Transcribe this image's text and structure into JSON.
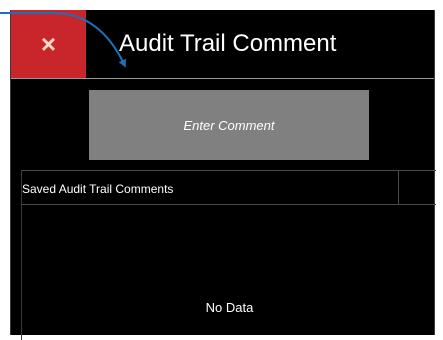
{
  "dialog": {
    "title": "Audit Trail Comment",
    "close_glyph": "×",
    "close_icon": "close-icon",
    "enter_comment_label": "Enter Comment"
  },
  "saved_comments": {
    "header": "Saved Audit Trail Comments",
    "empty_text": "No Data"
  },
  "annotation": {
    "arrow_color": "#1d6fb8",
    "icon": "callout-arrow-icon"
  },
  "colors": {
    "close_background": "#c8262b",
    "dialog_background": "#000000",
    "button_background": "#808080"
  }
}
